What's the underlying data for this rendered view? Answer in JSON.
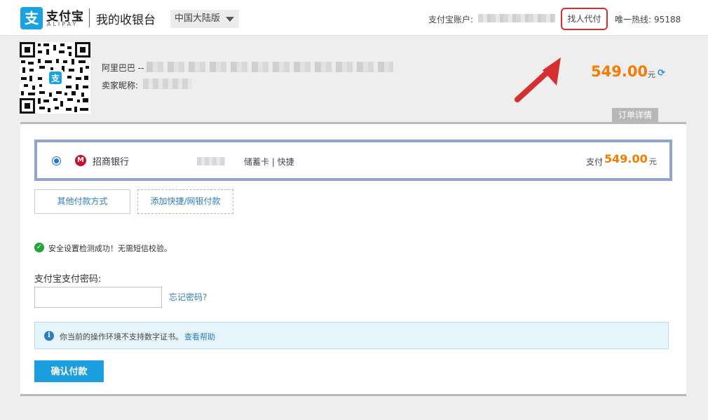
{
  "header": {
    "logo_char": "支",
    "logo_cn": "支付宝",
    "logo_en": "ALIPAY",
    "cashier_title": "我的收银台",
    "region": "中国大陆版",
    "account_label": "支付宝账户:",
    "proxy_pay": "找人代付",
    "hotline_label": "唯一热线:",
    "hotline_number": "95188",
    "accent_color": "#1aa1e1"
  },
  "merchant": {
    "name_prefix": "阿里巴巴 --",
    "nickname_label": "卖家昵称:",
    "qr_icon": "qr-code-icon"
  },
  "order": {
    "amount": "549.00",
    "currency": "元",
    "detail_tab": "订单详情",
    "amount_color": "#f57c00"
  },
  "payment": {
    "bank_name": "招商银行",
    "card_type": "储蓄卡 | 快捷",
    "pay_label": "支付",
    "pay_amount": "549.00",
    "pay_currency": "元",
    "other_method": "其他付款方式",
    "add_method": "添加快捷/网银付款"
  },
  "security": {
    "success_msg": "安全设置检测成功！无需短信校验。",
    "password_label": "支付宝支付密码:",
    "forgot_password": "忘记密码?"
  },
  "notice": {
    "text": "你当前的操作环境不支持数字证书。",
    "help_link": "查看帮助"
  },
  "actions": {
    "confirm": "确认付款"
  }
}
